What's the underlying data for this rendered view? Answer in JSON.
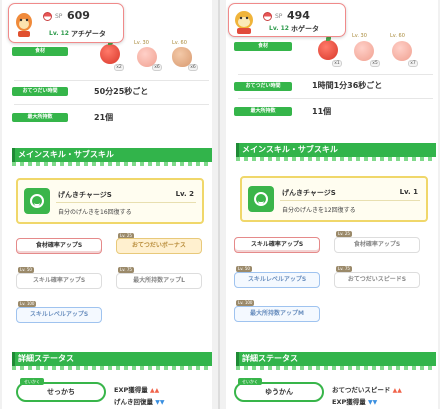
{
  "left": {
    "header": {
      "sp_label": "SP",
      "sp_value": "609",
      "level": "Lv. 12",
      "name": "アチゲータ"
    },
    "labels": {
      "ingredients": "食材",
      "help_time": "おてつだい時間",
      "max_items": "最大所持数"
    },
    "ingredients": [
      {
        "unlock": "",
        "qty": "x2",
        "kind": "apple"
      },
      {
        "unlock": "Lv. 30",
        "qty": "x6",
        "kind": "peach"
      },
      {
        "unlock": "Lv. 60",
        "qty": "x6",
        "kind": "bread"
      }
    ],
    "help_time": "50分25秒ごと",
    "max_items": "21個",
    "skill_section": "メインスキル・サブスキル",
    "skill": {
      "name": "げんきチャージS",
      "level": "Lv. 2",
      "desc": "自分のげんきを16回復する"
    },
    "subskills": [
      {
        "label": "食材確率アップS",
        "tag": "",
        "style": "sel"
      },
      {
        "label": "おてつだいボーナス",
        "tag": "Lv. 25",
        "style": "gold"
      },
      {
        "label": "スキル確率アップS",
        "tag": "Lv. 50",
        "style": "dim"
      },
      {
        "label": "最大所持数アップL",
        "tag": "Lv. 75",
        "style": "dim"
      },
      {
        "label": "スキルレベルアップS",
        "tag": "Lv. 100",
        "style": "blue"
      }
    ],
    "detail_section": "詳細ステータス",
    "nature_tag": "せいかく",
    "nature": "せっかち",
    "stats": [
      {
        "label": "EXP獲得量",
        "arrow": "▲▲",
        "dir": "up"
      },
      {
        "label": "げんき回復量",
        "arrow": "▼▼",
        "dir": "down"
      }
    ]
  },
  "right": {
    "header": {
      "sp_label": "SP",
      "sp_value": "494",
      "level": "Lv. 12",
      "name": "ホゲータ"
    },
    "labels": {
      "ingredients": "食材",
      "help_time": "おてつだい時間",
      "max_items": "最大所持数"
    },
    "ingredients": [
      {
        "unlock": "",
        "qty": "x1",
        "kind": "apple"
      },
      {
        "unlock": "Lv. 30",
        "qty": "x5",
        "kind": "peach"
      },
      {
        "unlock": "Lv. 60",
        "qty": "x7",
        "kind": "peach"
      }
    ],
    "help_time": "1時間1分36秒ごと",
    "max_items": "11個",
    "skill_section": "メインスキル・サブスキル",
    "skill": {
      "name": "げんきチャージS",
      "level": "Lv. 1",
      "desc": "自分のげんきを12回復する"
    },
    "subskills": [
      {
        "label": "スキル確率アップS",
        "tag": "",
        "style": "sel"
      },
      {
        "label": "食材確率アップS",
        "tag": "Lv. 25",
        "style": "dim"
      },
      {
        "label": "スキルレベルアップS",
        "tag": "Lv. 50",
        "style": "blue"
      },
      {
        "label": "おてつだいスピードS",
        "tag": "Lv. 75",
        "style": "dim"
      },
      {
        "label": "最大所持数アップM",
        "tag": "Lv. 100",
        "style": "blue"
      }
    ],
    "detail_section": "詳細ステータス",
    "nature_tag": "せいかく",
    "nature": "ゆうかん",
    "stats": [
      {
        "label": "おてつだいスピード",
        "arrow": "▲▲",
        "dir": "up"
      },
      {
        "label": "EXP獲得量",
        "arrow": "▼▼",
        "dir": "down"
      }
    ]
  }
}
